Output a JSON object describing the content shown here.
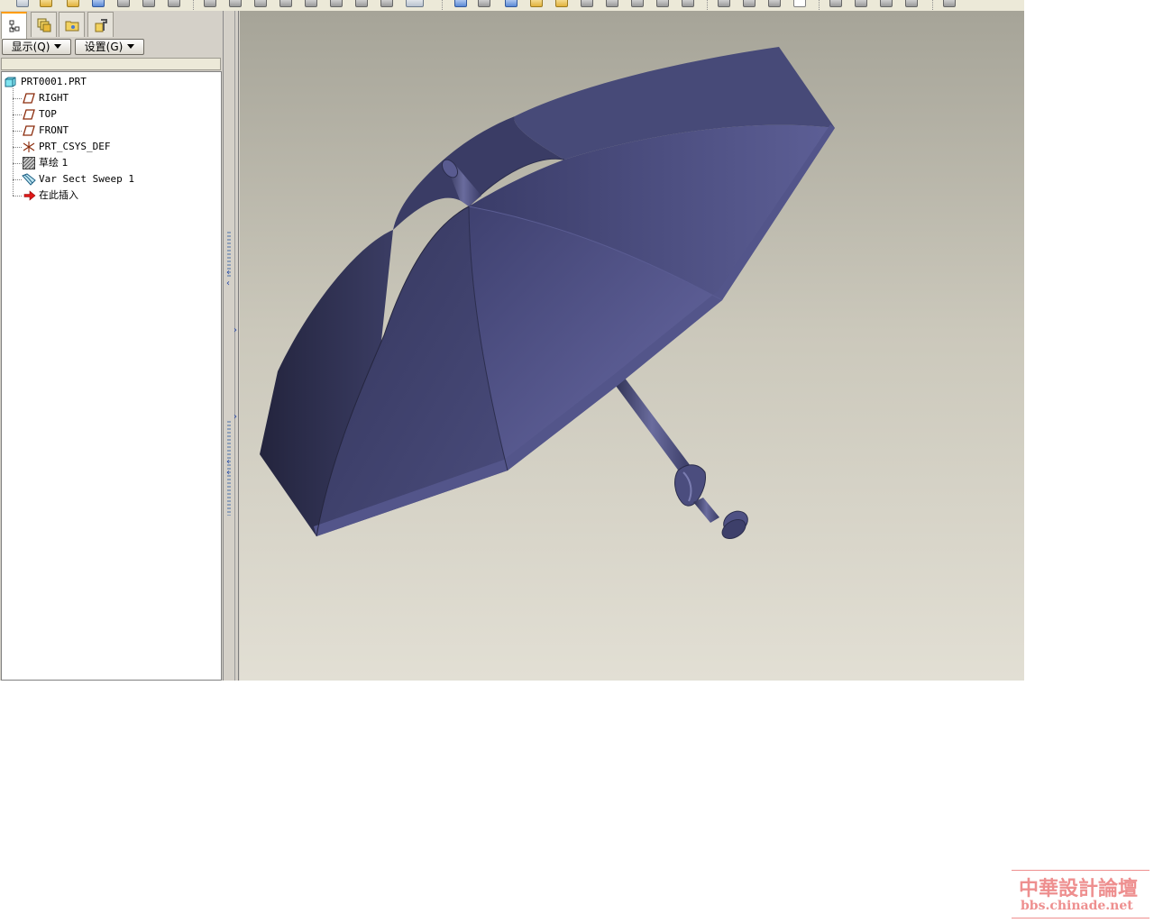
{
  "navigator": {
    "tabs": [
      {
        "name": "model-tree-tab",
        "icon": "model-tree-icon",
        "active": true
      },
      {
        "name": "layer-tab",
        "icon": "layers-icon",
        "active": false
      },
      {
        "name": "folder-browser-tab",
        "icon": "folder-icon",
        "active": false
      },
      {
        "name": "favorites-tab",
        "icon": "tools-icon",
        "active": false
      }
    ],
    "show_menu_label": "显示(Q)",
    "settings_menu_label": "设置(G)",
    "tree": [
      {
        "label": "PRT0001.PRT",
        "icon": "part-icon",
        "level": 0
      },
      {
        "label": "RIGHT",
        "icon": "datum-plane-icon",
        "level": 1
      },
      {
        "label": "TOP",
        "icon": "datum-plane-icon",
        "level": 1
      },
      {
        "label": "FRONT",
        "icon": "datum-plane-icon",
        "level": 1
      },
      {
        "label": "PRT_CSYS_DEF",
        "icon": "coordinate-system-icon",
        "level": 1
      },
      {
        "label": "草绘 1",
        "icon": "sketch-icon",
        "level": 1
      },
      {
        "label": "Var Sect Sweep 1",
        "icon": "var-sect-sweep-icon",
        "level": 1
      },
      {
        "label": "在此插入",
        "icon": "insert-here-arrow-icon",
        "level": 1
      }
    ]
  },
  "viewport": {
    "model": "umbrella-3d-model",
    "colors": {
      "canopy_dark": "#2a2c4a",
      "canopy_mid": "#474a78",
      "canopy_light": "#6566a0",
      "handle": "#4a4c7a"
    }
  },
  "watermark": {
    "title": "中華設計論壇",
    "url": "bbs.chinade.net",
    "color": "#ee8f8f"
  }
}
